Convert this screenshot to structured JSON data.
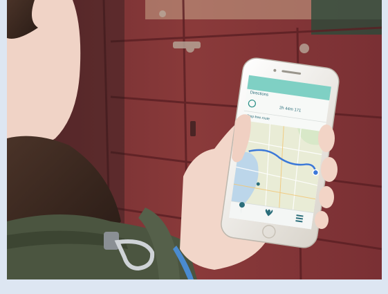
{
  "photo": {
    "colors": {
      "page_background": "#dde6f2",
      "wall_red": "#8a3a3a",
      "wall_dark": "#5e2226",
      "jacket_green": "#4b5540",
      "skin": "#f2d6c9",
      "hair": "#3a2a22",
      "phone_body": "#f2efe8",
      "screen_header": "#7fd0c4",
      "map_water": "#bcd6ea",
      "map_land": "#e9ecd6",
      "route_blue": "#3b78d8",
      "wristband": "#4a8bd0"
    },
    "phone_screen": {
      "header_text": "Directions",
      "route_summary": "2h 44m 171",
      "subtitle": "Step-free route",
      "icons": [
        "location-pin-icon",
        "heart-icon",
        "list-icon"
      ]
    }
  }
}
